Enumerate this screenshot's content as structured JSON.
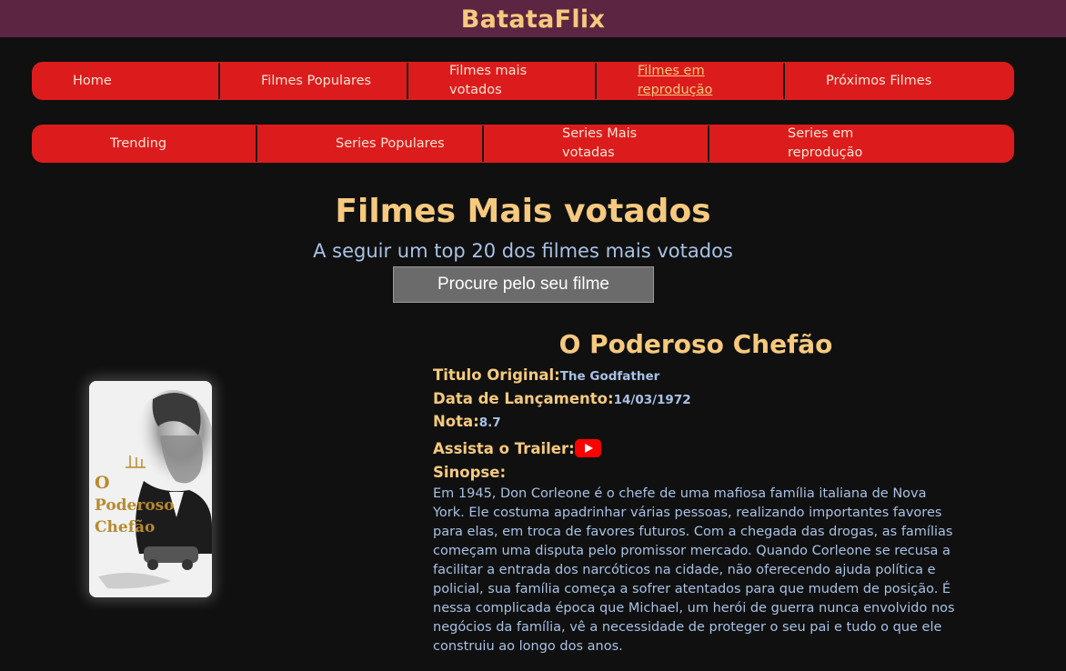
{
  "header": {
    "brand": "BatataFlix"
  },
  "nav_primary": [
    {
      "label": "Home"
    },
    {
      "label": "Filmes Populares"
    },
    {
      "label": "Filmes mais votados"
    },
    {
      "label": "Filmes em reprodução"
    },
    {
      "label": "Próximos Filmes"
    }
  ],
  "nav_secondary": [
    {
      "label": "Trending"
    },
    {
      "label": "Series Populares"
    },
    {
      "label": "Series Mais votadas"
    },
    {
      "label": "Series em reprodução"
    }
  ],
  "page": {
    "title": "Filmes Mais votados",
    "subtitle": "A seguir um top 20 dos filmes mais votados",
    "search_button": "Procure pelo seu filme"
  },
  "movie": {
    "title": "O Poderoso Chefão",
    "original_title_label": "Titulo Original:",
    "original_title": "The Godfather",
    "release_label": "Data de Lançamento:",
    "release_date": "14/03/1972",
    "rating_label": "Nota:",
    "rating": "8.7",
    "trailer_label": "Assista o Trailer:",
    "trailer_icon": "youtube-icon",
    "synopsis_label": "Sinopse:",
    "synopsis": "Em 1945, Don Corleone é o chefe de uma mafiosa família italiana de Nova York. Ele costuma apadrinhar várias pessoas, realizando importantes favores para elas, em troca de favores futuros. Com a chegada das drogas, as famílias começam uma disputa pelo promissor mercado. Quando Corleone se recusa a facilitar a entrada dos narcóticos na cidade, não oferecendo ajuda política e policial, sua família começa a sofrer atentados para que mudem de posição. É nessa complicada época que Michael, um herói de guerra nunca envolvido nos negócios da família, vê a necessidade de proteger o seu pai e tudo o que ele construiu ao longo dos anos.",
    "poster_text": "O Poderoso Chefão"
  },
  "colors": {
    "background": "#0f100f",
    "topbar": "#5c2541",
    "nav": "#dc1c1c",
    "accent": "#f6c97f",
    "text": "#a9c1e6"
  }
}
